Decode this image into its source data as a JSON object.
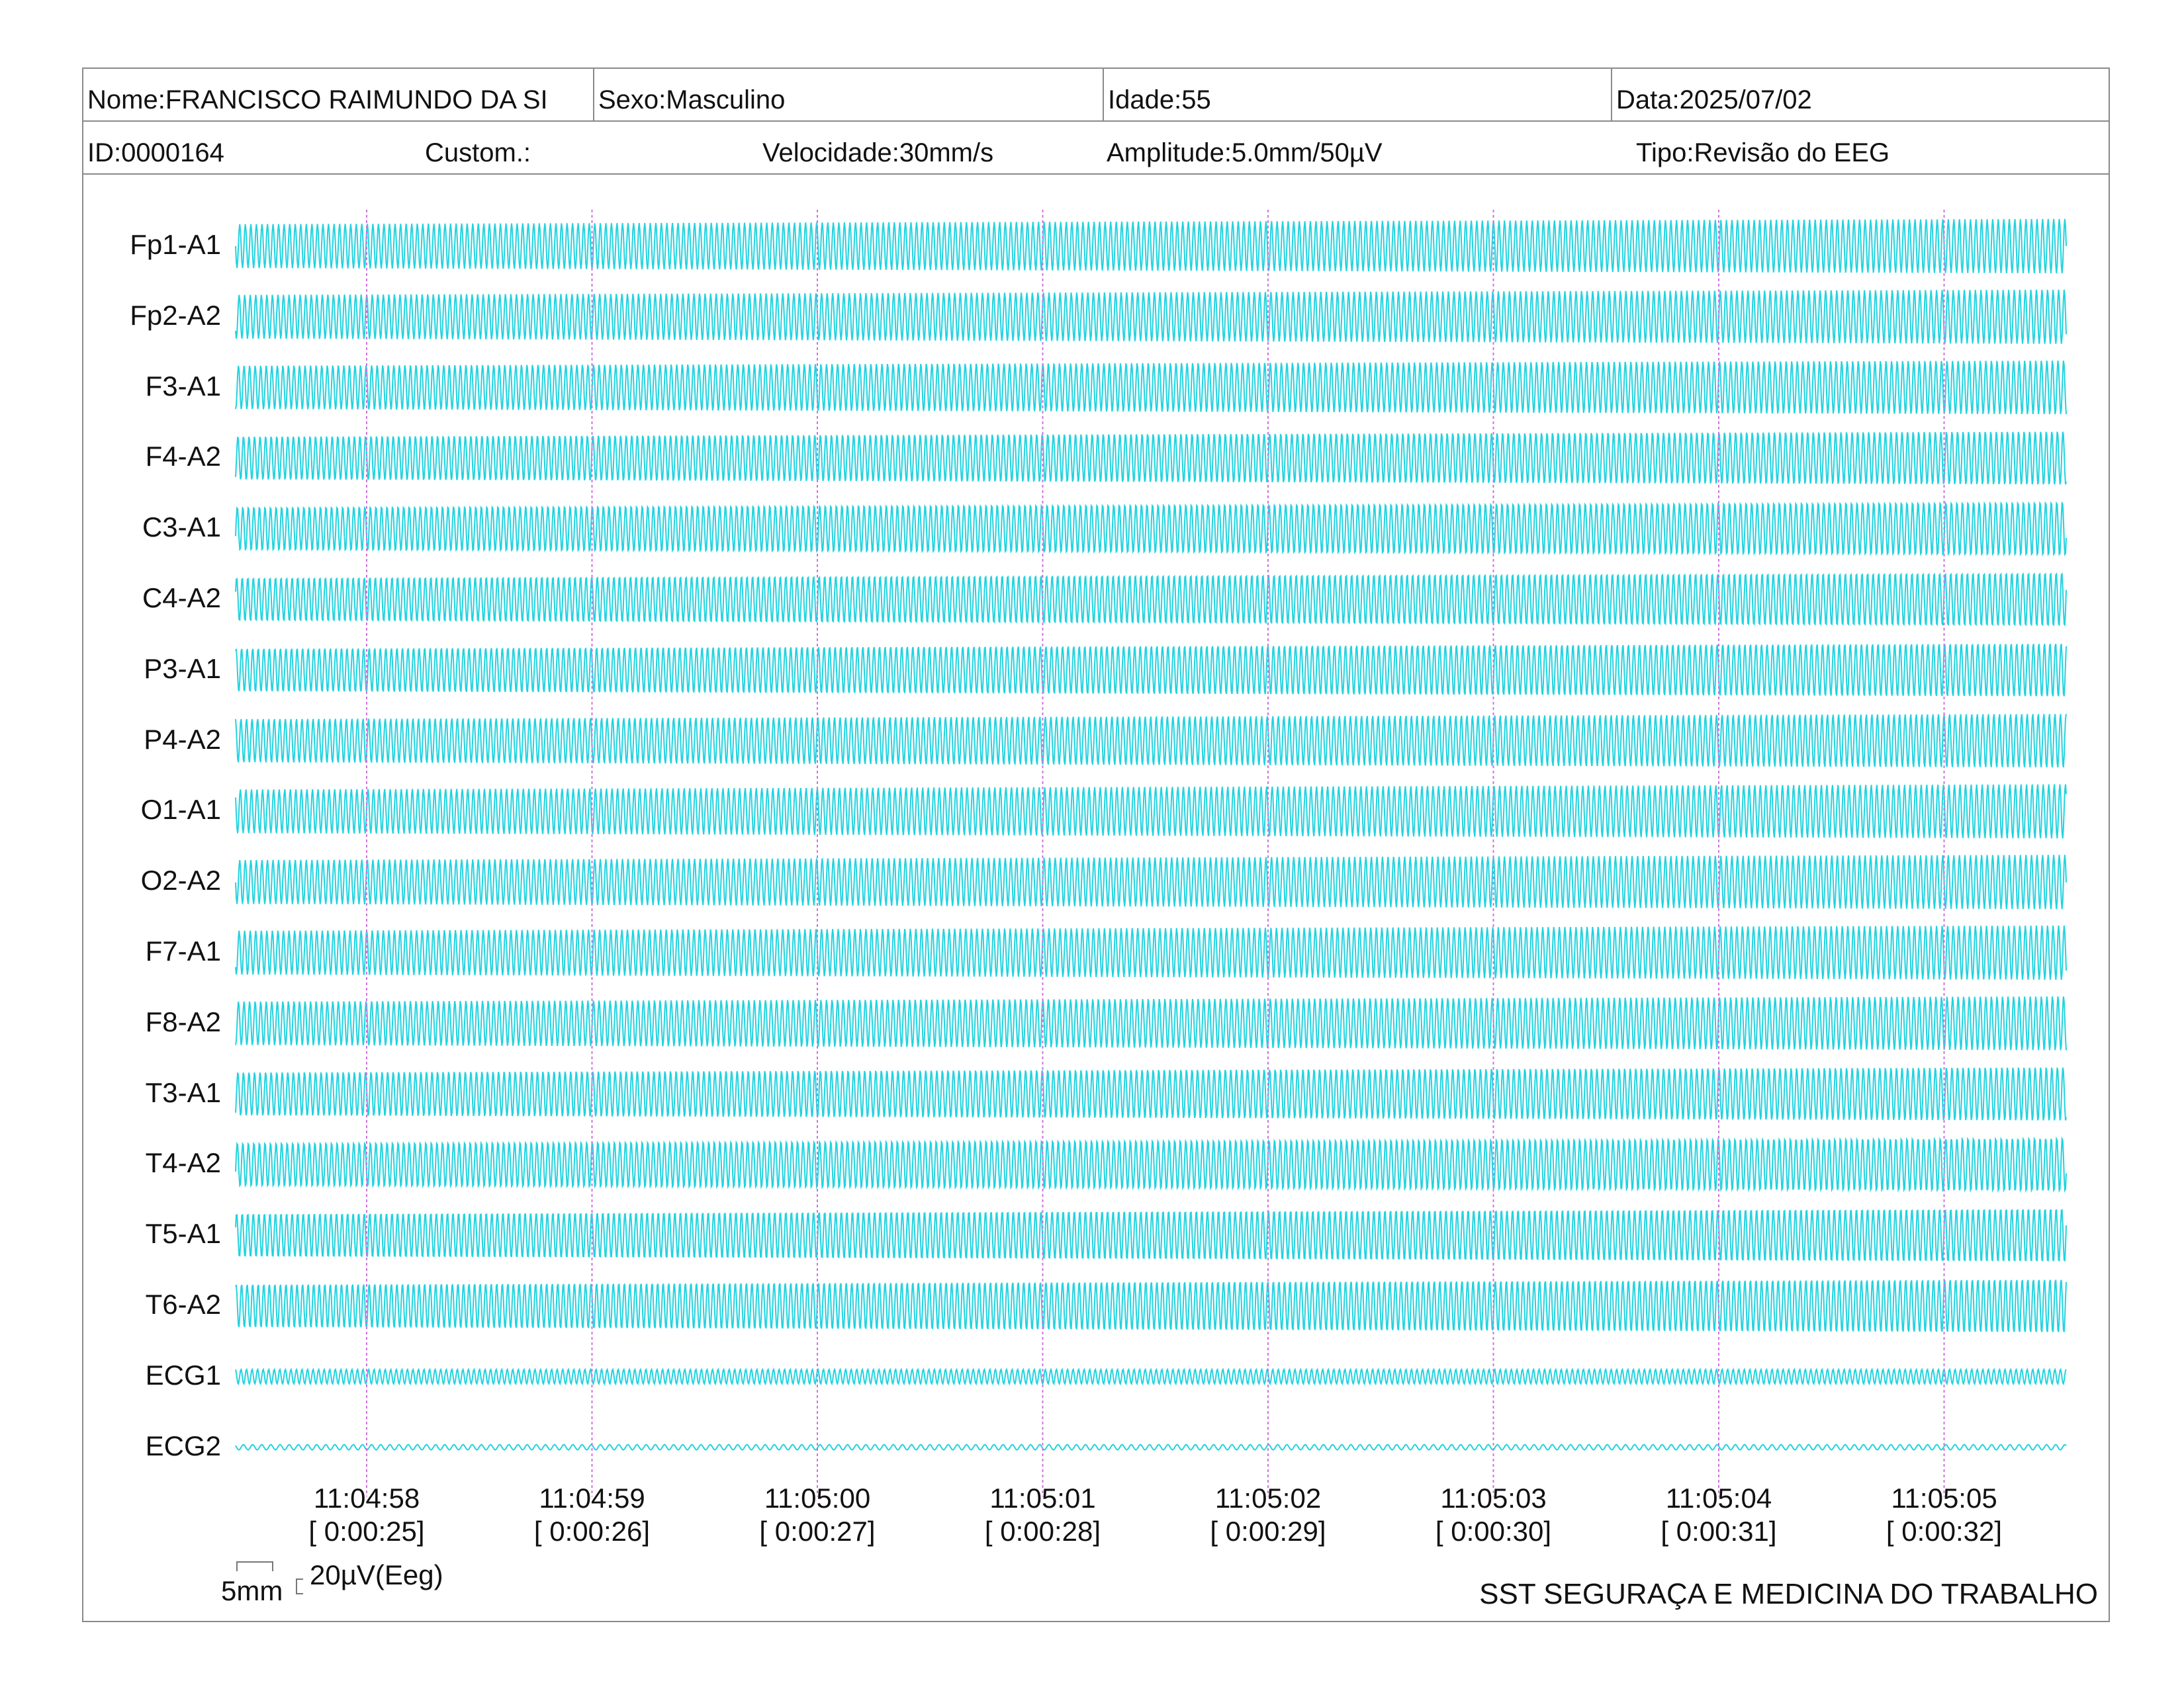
{
  "header": {
    "name": "Nome:FRANCISCO RAIMUNDO DA SI",
    "sex": "Sexo:Masculino",
    "age": "Idade:55",
    "date": "Data:2025/07/02",
    "id": "ID:0000164",
    "custom": "Custom.:",
    "speed": "Velocidade:30mm/s",
    "amplitude": "Amplitude:5.0mm/50µV",
    "type": "Tipo:Revisão do EEG"
  },
  "chart_data": {
    "type": "line",
    "channels": [
      "Fp1-A1",
      "Fp2-A2",
      "F3-A1",
      "F4-A2",
      "C3-A1",
      "C4-A2",
      "P3-A1",
      "P4-A2",
      "O1-A1",
      "O2-A2",
      "F7-A1",
      "F8-A2",
      "T3-A1",
      "T4-A2",
      "T5-A1",
      "T6-A2",
      "ECG1",
      "ECG2"
    ],
    "time_ticks": [
      {
        "clock": "11:04:58",
        "elapsed": "[ 0:00:25]"
      },
      {
        "clock": "11:04:59",
        "elapsed": "[ 0:00:26]"
      },
      {
        "clock": "11:05:00",
        "elapsed": "[ 0:00:27]"
      },
      {
        "clock": "11:05:01",
        "elapsed": "[ 0:00:28]"
      },
      {
        "clock": "11:05:02",
        "elapsed": "[ 0:00:29]"
      },
      {
        "clock": "11:05:03",
        "elapsed": "[ 0:00:30]"
      },
      {
        "clock": "11:05:04",
        "elapsed": "[ 0:00:31]"
      },
      {
        "clock": "11:05:05",
        "elapsed": "[ 0:00:32]"
      }
    ],
    "wave_color": "#22d3df",
    "marker_color": "#d070e0",
    "grid": false
  },
  "scale": {
    "time_label": "5mm",
    "amp_label": "20µV(Eeg)"
  },
  "footer": {
    "company": "SST SEGURAÇA E MEDICINA DO TRABALHO"
  }
}
